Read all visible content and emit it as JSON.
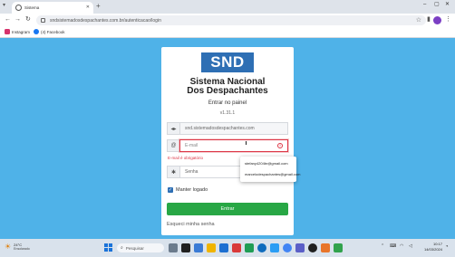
{
  "browser": {
    "tab_title": "Sistema",
    "tab_close": "✕",
    "new_tab": "+",
    "url": "sndsistemadosdespachantes.com.br/autenticacao/login",
    "bookmarks": [
      {
        "label": "Instagram",
        "color": "#d6336c"
      },
      {
        "label": "(4) Facebook",
        "color": "#1877f2"
      }
    ]
  },
  "login": {
    "logo_text": "SND",
    "title_line1": "Sistema Nacional",
    "title_line2": "Dos Despachantes",
    "subtitle": "Entrar no painel",
    "version": "v1.31.1",
    "domain_value": "snd.sistemadosdespachantes.com",
    "email_placeholder": "E-mail",
    "email_error": "E-mail é obrigatório",
    "password_placeholder": "Senha",
    "remember_label": "Manter logado",
    "submit_label": "Entrar",
    "forgot_label": "Esqueci minha senha"
  },
  "autofill": {
    "options": [
      "stefany4204br@gmail.com",
      "marcelodespachantes@gmail.com"
    ]
  },
  "taskbar": {
    "weather_temp": "24°C",
    "weather_desc": "Ensolarado",
    "search_placeholder": "Pesquisar",
    "time": "10:17",
    "date": "14/03/2024"
  },
  "colors": {
    "page_bg": "#4fb2e8",
    "logo_bg": "#2e6fb4",
    "submit_bg": "#28a745",
    "error": "#dc3545"
  }
}
